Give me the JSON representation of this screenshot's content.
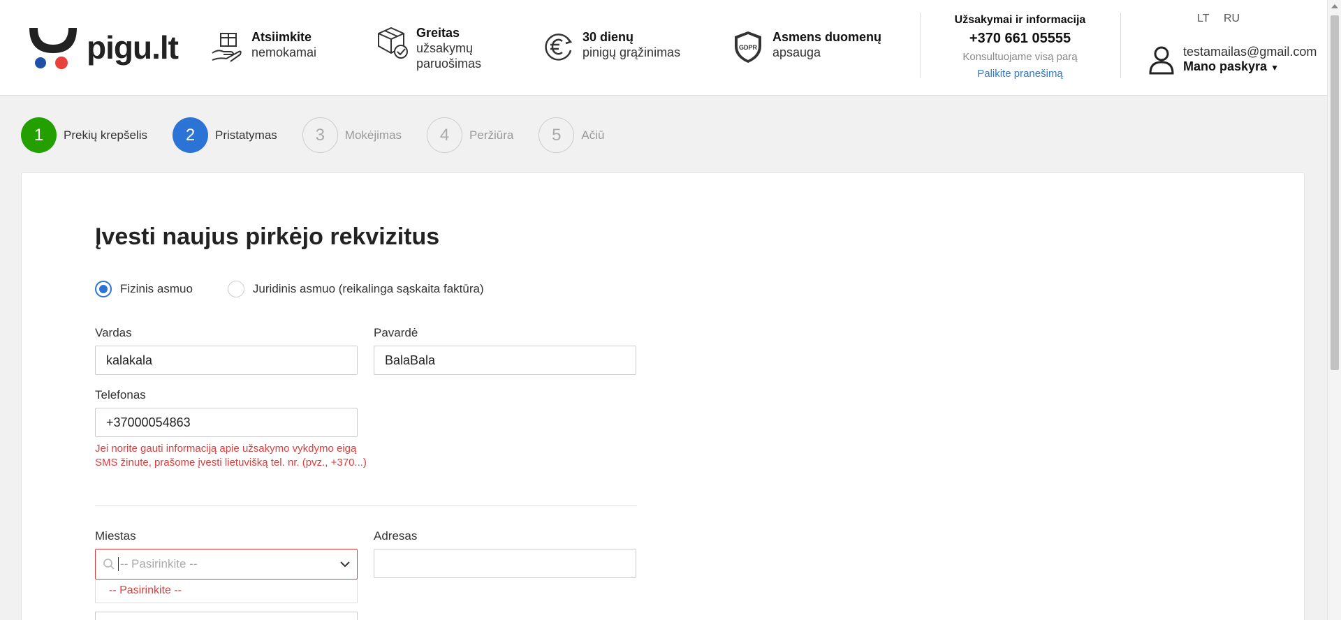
{
  "header": {
    "logo_text": "pigu.lt",
    "features": [
      {
        "icon": "hand-box-icon",
        "title": "Atsiimkite",
        "lines": [
          "nemokamai"
        ]
      },
      {
        "icon": "package-check-icon",
        "title": "Greitas",
        "lines": [
          "užsakymų",
          "paruošimas"
        ]
      },
      {
        "icon": "euro-refund-icon",
        "title": "30 dienų",
        "lines": [
          "pinigų grąžinimas"
        ]
      },
      {
        "icon": "gdpr-shield-icon",
        "title": "Asmens duomenų",
        "lines": [
          "apsauga"
        ]
      }
    ],
    "contact": {
      "title": "Užsakymai ir informacija",
      "phone": "+370 661 05555",
      "subtitle": "Konsultuojame visą parą",
      "link": "Palikite pranešimą"
    },
    "languages": [
      "LT",
      "RU"
    ],
    "account": {
      "email": "testamailas@gmail.com",
      "label": "Mano paskyra"
    }
  },
  "steps": [
    {
      "number": "1",
      "label": "Prekių krepšelis",
      "state": "done"
    },
    {
      "number": "2",
      "label": "Pristatymas",
      "state": "active"
    },
    {
      "number": "3",
      "label": "Mokėjimas",
      "state": "todo"
    },
    {
      "number": "4",
      "label": "Peržiūra",
      "state": "todo"
    },
    {
      "number": "5",
      "label": "Ačiū",
      "state": "todo"
    }
  ],
  "form": {
    "title": "Įvesti naujus pirkėjo rekvizitus",
    "buyer_type": {
      "options": [
        "Fizinis asmuo",
        "Juridinis asmuo (reikalinga sąskaita faktūra)"
      ],
      "selected": "Fizinis asmuo"
    },
    "first_name": {
      "label": "Vardas",
      "value": "kalakala"
    },
    "last_name": {
      "label": "Pavardė",
      "value": "BalaBala"
    },
    "phone": {
      "label": "Telefonas",
      "value": "+37000054863",
      "hint": "Jei norite gauti informaciją apie užsakymo vykdymo eigą SMS žinute, prašome įvesti lietuvišką tel. nr. (pvz., +370...)"
    },
    "city": {
      "label": "Miestas",
      "placeholder": "-- Pasirinkite --",
      "dropdown_option": "-- Pasirinkite --"
    },
    "address": {
      "label": "Adresas",
      "value": ""
    }
  },
  "colors": {
    "step_done": "#23a000",
    "step_active": "#2b74d6",
    "error": "#e03c3c",
    "link": "#2b7ad1",
    "logo_red": "#e8413b",
    "logo_blue": "#1f4fa8"
  }
}
